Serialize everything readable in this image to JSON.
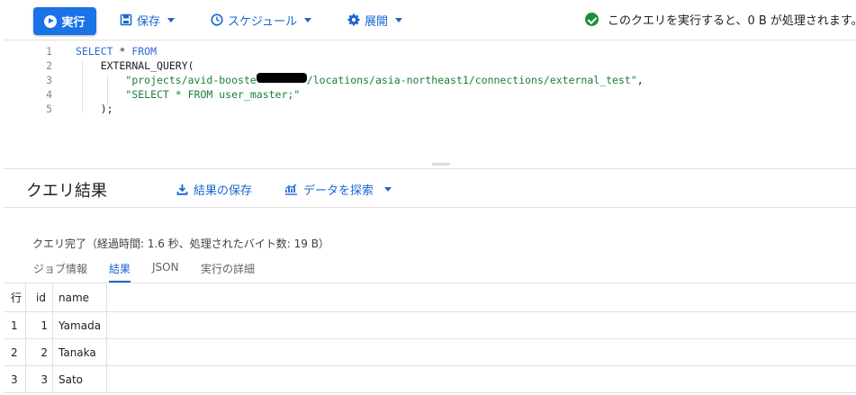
{
  "toolbar": {
    "run_label": "実行",
    "save_label": "保存",
    "schedule_label": "スケジュール",
    "deploy_label": "展開",
    "status_text": "このクエリを実行すると、0 B が処理されます。"
  },
  "editor": {
    "lines": [
      {
        "num": "1",
        "kw": "SELECT",
        "rest": " * ",
        "kw2": "FROM"
      },
      {
        "num": "2",
        "fn": "EXTERNAL_QUERY",
        "pn": "("
      },
      {
        "num": "3",
        "str_a": "\"projects/avid-booste",
        "str_b": "/locations/asia-northeast1/connections/external_test\"",
        "pn": ","
      },
      {
        "num": "4",
        "str": "\"SELECT * FROM user_master;\""
      },
      {
        "num": "5",
        "pn": ");"
      }
    ]
  },
  "results": {
    "title": "クエリ結果",
    "save_results_label": "結果の保存",
    "explore_label": "データを探索",
    "summary": "クエリ完了（経過時間: 1.6 秒、処理されたバイト数: 19 B）",
    "tabs": [
      {
        "label": "ジョブ情報"
      },
      {
        "label": "結果"
      },
      {
        "label": "JSON"
      },
      {
        "label": "実行の詳細"
      }
    ],
    "columns": [
      "行",
      "id",
      "name"
    ],
    "rows": [
      {
        "row": "1",
        "id": "1",
        "name": "Yamada"
      },
      {
        "row": "2",
        "id": "2",
        "name": "Tanaka"
      },
      {
        "row": "3",
        "id": "3",
        "name": "Sato"
      }
    ]
  },
  "colors": {
    "accent": "#1a73e8",
    "link": "#1967d2",
    "success": "#1e8e3e",
    "string": "#188038",
    "keyword": "#3367d6"
  },
  "icons": {
    "run": "play-icon",
    "save": "save-icon",
    "schedule": "clock-icon",
    "deploy": "gear-icon",
    "status": "check-circle-icon",
    "save_results": "download-icon",
    "explore": "chart-icon"
  }
}
